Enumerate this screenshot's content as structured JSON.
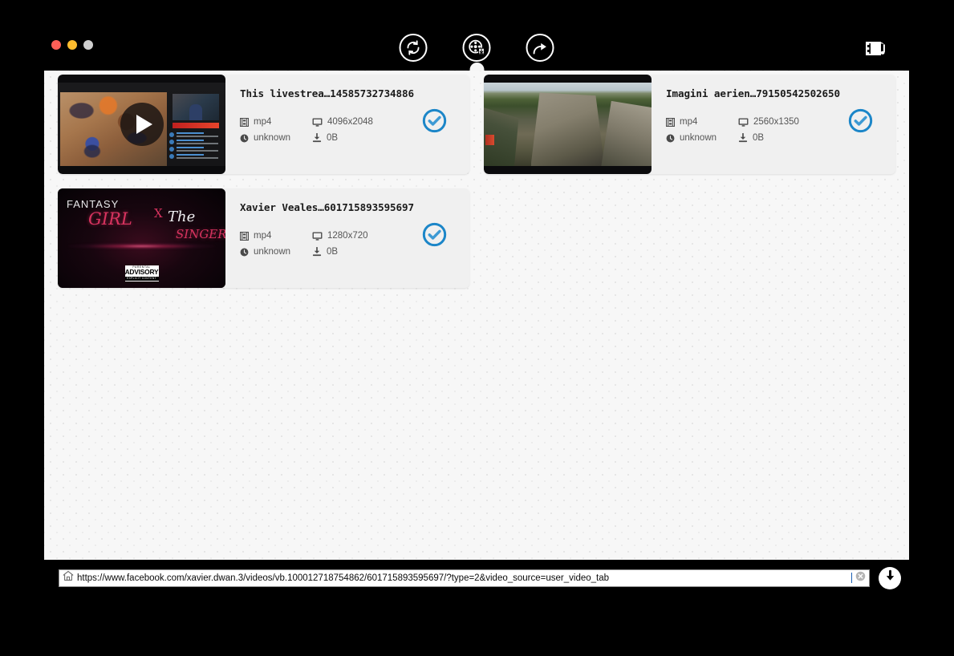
{
  "window": {
    "traffic_lights": [
      {
        "name": "close",
        "color": "#ff5f57"
      },
      {
        "name": "minimize",
        "color": "#febc2e"
      },
      {
        "name": "zoom",
        "color": "#cfcfcf"
      }
    ]
  },
  "toolbar": {
    "buttons": [
      {
        "name": "refresh-sync-button",
        "icon": "refresh-icon",
        "active": false
      },
      {
        "name": "video-downloads-button",
        "icon": "film-reel-download-icon",
        "active": true
      },
      {
        "name": "share-export-button",
        "icon": "share-icon",
        "active": false
      }
    ],
    "right_button": {
      "name": "video-to-audio-button",
      "icon": "film-music-icon"
    }
  },
  "cards": [
    {
      "title": "This livestrea…14585732734886",
      "format": "mp4",
      "resolution": "4096x2048",
      "duration": "unknown",
      "size": "0B",
      "selected": true,
      "thumb_kind": "livestream",
      "has_play_button": true
    },
    {
      "title": "Imagini aerien…79150542502650",
      "format": "mp4",
      "resolution": "2560x1350",
      "duration": "unknown",
      "size": "0B",
      "selected": true,
      "thumb_kind": "canyon",
      "has_play_button": false
    },
    {
      "title": "Xavier Veales…601715893595697",
      "format": "mp4",
      "resolution": "1280x720",
      "duration": "unknown",
      "size": "0B",
      "selected": true,
      "thumb_kind": "music",
      "has_play_button": false
    }
  ],
  "music_art": {
    "line1": "FANTASY",
    "line2": "GIRL",
    "x": "X",
    "the": "The",
    "singer": "SINGER",
    "advisory_top": "PARENTAL",
    "advisory_mid": "ADVISORY",
    "advisory_bottom": "EXPLICIT CONTENT"
  },
  "urlbar": {
    "value": "https://www.facebook.com/xavier.dwan.3/videos/vb.100012718754862/601715893595697/?type=2&video_source=user_video_tab",
    "home_icon": "home-icon",
    "clear_icon": "clear-circle-icon",
    "download_icon": "download-arrow-icon"
  },
  "colors": {
    "accent_blue": "#1c86c8",
    "chrome_black": "#000000",
    "card_bg": "#f0f0f0",
    "content_bg": "#f7f7f7"
  }
}
